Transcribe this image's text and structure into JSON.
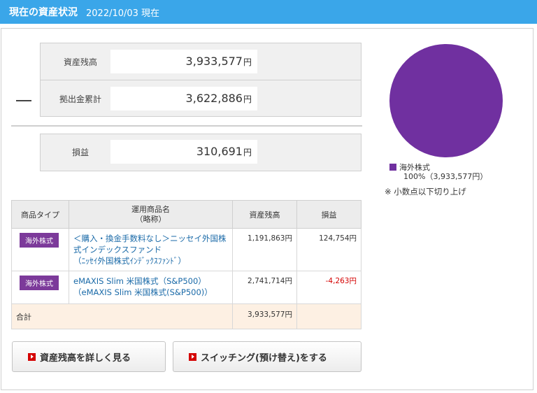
{
  "header": {
    "title": "現在の資産状況",
    "date": "2022/10/03 現在"
  },
  "summary": {
    "balance_label": "資産残高",
    "balance_value": "3,933,577",
    "balance_unit": "円",
    "contrib_label": "拠出金累計",
    "contrib_value": "3,622,886",
    "contrib_unit": "円",
    "profit_label": "損益",
    "profit_value": "310,691",
    "profit_unit": "円"
  },
  "table": {
    "headers": [
      "商品タイプ",
      "運用商品名\n（略称）",
      "資産残高",
      "損益"
    ],
    "rows": [
      {
        "type": "海外株式",
        "name_line1": "＜購入・換金手数料なし＞ニッセイ外国株",
        "name_line2": "式インデックスファンド",
        "short": "（ﾆｯｾｲ外国株式ｲﾝﾃﾞｯｸｽﾌｧﾝﾄﾞ）",
        "balance": "1,191,863円",
        "profit": "124,754円"
      },
      {
        "type": "海外株式",
        "name_line1": "eMAXIS Slim 米国株式（S&P500）",
        "name_line2": "",
        "short": "（eMAXIS Slim 米国株式(S&P500)）",
        "balance": "2,741,714円",
        "profit": "-4,263円"
      }
    ],
    "total_label": "合計",
    "total_balance": "3,933,577円"
  },
  "buttons": {
    "detail": "資産残高を詳しく見る",
    "switching": "スイッチング(預け替え)をする"
  },
  "chart_data": {
    "type": "pie",
    "slices": [
      {
        "label": "海外株式",
        "percent": 100,
        "value": 3933577,
        "color": "#7030a0"
      }
    ]
  },
  "legend": {
    "label": "海外株式",
    "detail": "100%（3,933,577円）"
  },
  "note": "※ 小数点以下切り上げ",
  "colors": {
    "header": "#3aa6e9",
    "badge": "#7c3a9a",
    "negative": "#d40000",
    "pie": "#7030a0"
  }
}
